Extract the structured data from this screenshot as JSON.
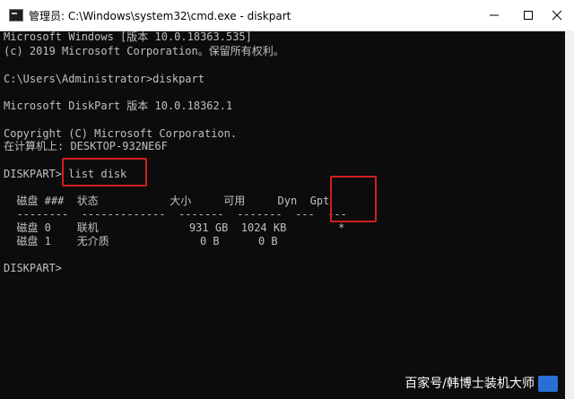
{
  "window": {
    "title": "管理员: C:\\Windows\\system32\\cmd.exe - diskpart",
    "icon": "cmd-icon",
    "controls": [
      "minimize-icon",
      "maximize-icon",
      "close-icon"
    ]
  },
  "terminal": {
    "lines": [
      "Microsoft Windows [版本 10.0.18363.535]",
      "(c) 2019 Microsoft Corporation。保留所有权利。",
      "",
      "C:\\Users\\Administrator>diskpart",
      "",
      "Microsoft DiskPart 版本 10.0.18362.1",
      "",
      "Copyright (C) Microsoft Corporation.",
      "在计算机上: DESKTOP-932NE6F",
      "",
      "DISKPART> list disk",
      "",
      "  磁盘 ###  状态           大小     可用     Dyn  Gpt",
      "  --------  -------------  -------  -------  ---  ---",
      "  磁盘 0    联机              931 GB  1024 KB        *",
      "  磁盘 1    无介质              0 B      0 B",
      "",
      "DISKPART>"
    ]
  },
  "watermark": "百家号/韩博士装机大师",
  "colors": {
    "terminal_bg": "#0c0c0c",
    "terminal_text": "#c0c0c0",
    "highlight": "#d21e1e"
  }
}
